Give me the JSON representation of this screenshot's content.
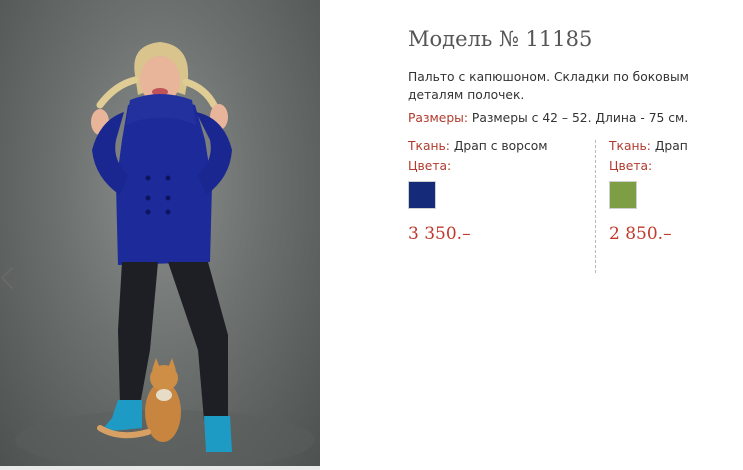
{
  "product": {
    "title": "Модель № 11185",
    "description": "Пальто с капюшоном. Складки по боковым деталям полочек.",
    "sizes_label": "Размеры:",
    "sizes_value": " Размеры с 42 – 52. Длина - 75 см."
  },
  "variants": [
    {
      "fabric_label": "Ткань:",
      "fabric_value": " Драп с ворсом",
      "colors_label": "Цвета:",
      "swatch_color": "#162a7a",
      "price": "3 350.–"
    },
    {
      "fabric_label": "Ткань:",
      "fabric_value": " Драп",
      "colors_label": "Цвета:",
      "swatch_color": "#7d9e45",
      "price": "2 850.–"
    }
  ],
  "colors": {
    "accent_red": "#b03a2e",
    "price_red": "#c0392b"
  }
}
